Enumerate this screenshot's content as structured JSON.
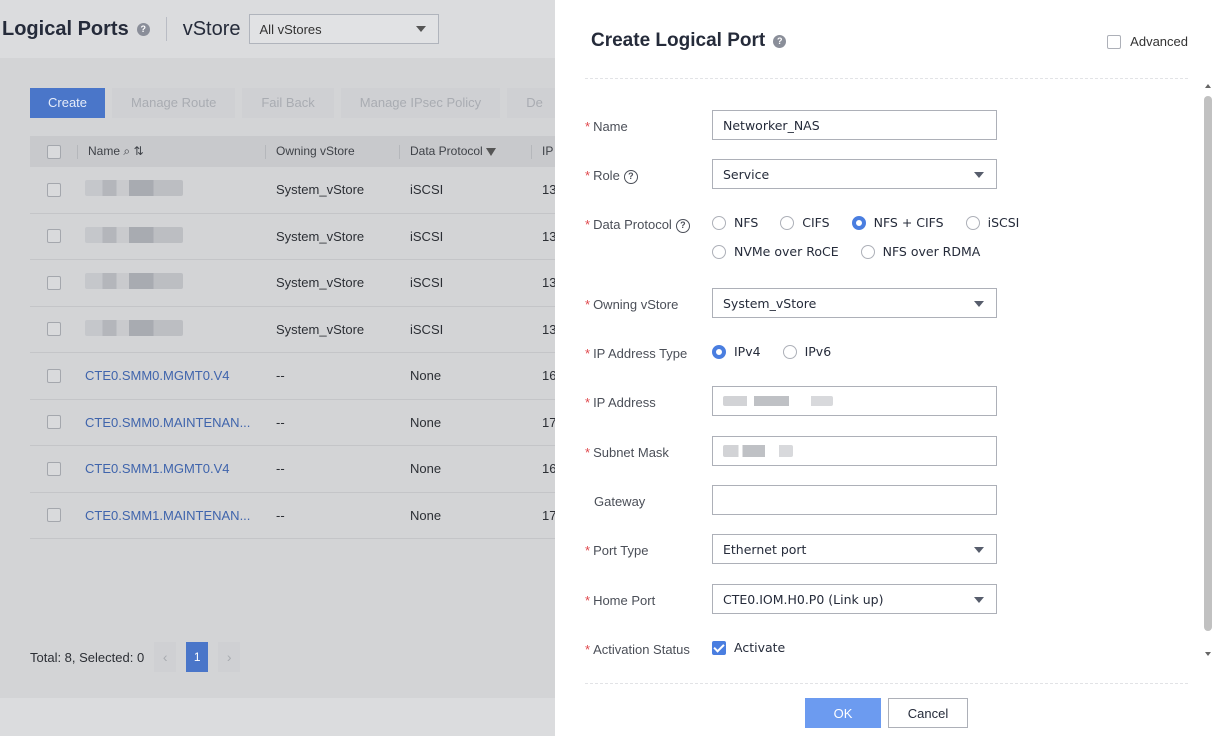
{
  "background": {
    "title": "Logical Ports",
    "vstore_label": "vStore",
    "vstore_selected": "All vStores",
    "toolbar": [
      "Create",
      "Manage Route",
      "Fail Back",
      "Manage IPsec Policy",
      "De"
    ],
    "columns": [
      "Name",
      "Owning vStore",
      "Data Protocol",
      "IP"
    ],
    "rows": [
      {
        "name": "",
        "owner": "System_vStore",
        "protocol": "iSCSI",
        "ip": "13",
        "blurred": true
      },
      {
        "name": "",
        "owner": "System_vStore",
        "protocol": "iSCSI",
        "ip": "13",
        "blurred": true
      },
      {
        "name": "",
        "owner": "System_vStore",
        "protocol": "iSCSI",
        "ip": "13",
        "blurred": true
      },
      {
        "name": "",
        "owner": "System_vStore",
        "protocol": "iSCSI",
        "ip": "13",
        "blurred": true
      },
      {
        "name": "CTE0.SMM0.MGMT0.V4",
        "owner": "--",
        "protocol": "None",
        "ip": "16"
      },
      {
        "name": "CTE0.SMM0.MAINTENAN...",
        "owner": "--",
        "protocol": "None",
        "ip": "17"
      },
      {
        "name": "CTE0.SMM1.MGMT0.V4",
        "owner": "--",
        "protocol": "None",
        "ip": "16"
      },
      {
        "name": "CTE0.SMM1.MAINTENAN...",
        "owner": "--",
        "protocol": "None",
        "ip": "17"
      }
    ],
    "footer": {
      "summary": "Total: 8, Selected: 0",
      "page": "1",
      "prev": "‹",
      "next": "›"
    }
  },
  "drawer": {
    "title": "Create Logical Port",
    "advanced_label": "Advanced",
    "fields": {
      "name": {
        "label": "Name",
        "value": "Networker_NAS"
      },
      "role": {
        "label": "Role",
        "value": "Service"
      },
      "data_protocol": {
        "label": "Data Protocol",
        "options": [
          "NFS",
          "CIFS",
          "NFS + CIFS",
          "iSCSI",
          "NVMe over RoCE",
          "NFS over RDMA"
        ],
        "selected": "NFS + CIFS"
      },
      "owning_vstore": {
        "label": "Owning vStore",
        "value": "System_vStore"
      },
      "ip_address_type": {
        "label": "IP Address Type",
        "options": [
          "IPv4",
          "IPv6"
        ],
        "selected": "IPv4"
      },
      "ip_address": {
        "label": "IP Address",
        "value": ""
      },
      "subnet_mask": {
        "label": "Subnet Mask",
        "value": ""
      },
      "gateway": {
        "label": "Gateway",
        "value": ""
      },
      "port_type": {
        "label": "Port Type",
        "value": "Ethernet port"
      },
      "home_port": {
        "label": "Home Port",
        "value": "CTE0.IOM.H0.P0 (Link up)"
      },
      "activation_status": {
        "label": "Activation Status",
        "checkbox_label": "Activate",
        "checked": true
      }
    },
    "required_mark": "*",
    "help_mark": "?",
    "info_mark": "?",
    "ok_label": "OK",
    "cancel_label": "Cancel"
  },
  "colors": {
    "accent": "#4a7ee0",
    "required": "#e0474c",
    "link": "#3f64ac",
    "overlay": "#dbdcde"
  }
}
